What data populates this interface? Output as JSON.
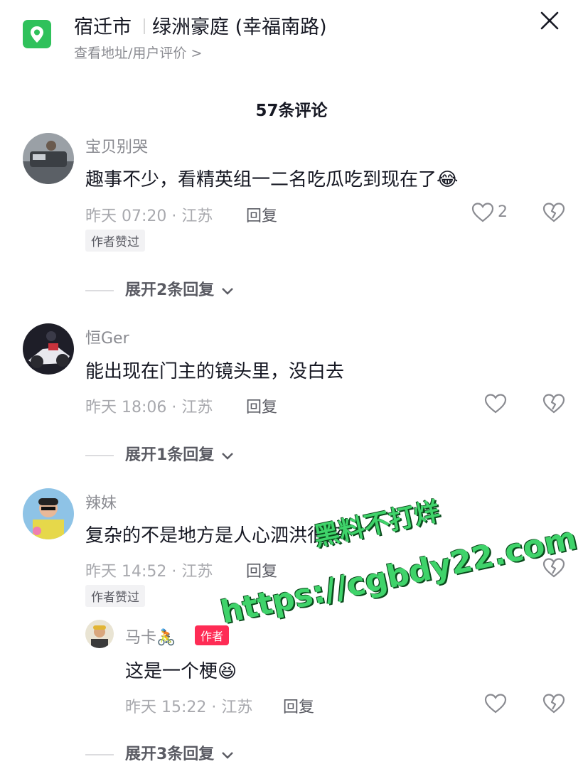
{
  "header": {
    "city": "宿迁市",
    "place": "绿洲豪庭 (幸福南路)",
    "sub_link": "查看地址/用户评价 >"
  },
  "comment_count": "57条评论",
  "comments": [
    {
      "user": "宝贝别哭",
      "text": "趣事不少，看精英组一二名吃瓜吃到现在了",
      "emoji": "😂",
      "meta": "昨天 07:20 · 江苏",
      "reply_label": "回复",
      "likes": "2",
      "tag": "作者赞过",
      "expand": "展开2条回复"
    },
    {
      "user": "恒Ger",
      "text": "能出现在门主的镜头里，没白去",
      "meta": "昨天 18:06 · 江苏",
      "reply_label": "回复",
      "expand": "展开1条回复"
    },
    {
      "user": "辣妹",
      "text": "复杂的不是地方是人心泗洪很好",
      "meta": "昨天 14:52 · 江苏",
      "reply_label": "回复",
      "tag": "作者赞过",
      "reply": {
        "user": "马卡🚴",
        "badge": "作者",
        "text": "这是一个梗",
        "emoji": "😆",
        "meta": "昨天 15:22 · 江苏",
        "reply_label": "回复"
      },
      "expand": "展开3条回复"
    }
  ],
  "watermark": {
    "line1": "黑料不打烊",
    "line2": "https://cgbdy22.com"
  },
  "icons": {
    "location": "location-pin-icon",
    "close": "close-icon",
    "heart": "heart-icon",
    "dislike": "broken-heart-icon",
    "chevron": "chevron-down-icon"
  },
  "colors": {
    "location_icon_bg": "#2fc15b",
    "author_badge": "#fe2c55",
    "watermark": "#3fd36a"
  }
}
